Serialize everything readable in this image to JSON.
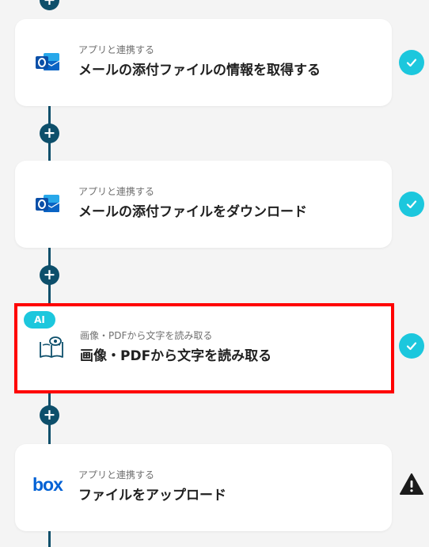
{
  "flow": {
    "steps": [
      {
        "id": "step-1",
        "subtitle": "アプリと連携する",
        "title": "メールの添付ファイルの情報を取得する",
        "app_icon": "outlook-icon",
        "status": "completed",
        "status_icon": "check-icon",
        "highlighted": false,
        "ai": false
      },
      {
        "id": "step-2",
        "subtitle": "アプリと連携する",
        "title": "メールの添付ファイルをダウンロード",
        "app_icon": "outlook-icon",
        "status": "completed",
        "status_icon": "check-icon",
        "highlighted": false,
        "ai": false
      },
      {
        "id": "step-3",
        "badge": "AI",
        "subtitle": "画像・PDFから文字を読み取る",
        "title": "画像・PDFから文字を読み取る",
        "app_icon": "book-eye-icon",
        "status": "completed",
        "status_icon": "check-icon",
        "highlighted": true,
        "ai": true
      },
      {
        "id": "step-4",
        "subtitle": "アプリと連携する",
        "title": "ファイルをアップロード",
        "app_icon": "box-logo",
        "logo_text": "box",
        "status": "warning",
        "status_icon": "warning-icon",
        "highlighted": false,
        "ai": false
      }
    ],
    "add_step_icon": "plus-icon"
  },
  "colors": {
    "connector": "#0d4f6b",
    "check": "#1cc7dd",
    "ai_badge": "#1cc7dd",
    "highlight_border": "#ff0000",
    "outlook_blue": "#0a64c4",
    "box_blue": "#0061d5",
    "warning": "#1b1b1b",
    "background": "#f4f4f4"
  }
}
